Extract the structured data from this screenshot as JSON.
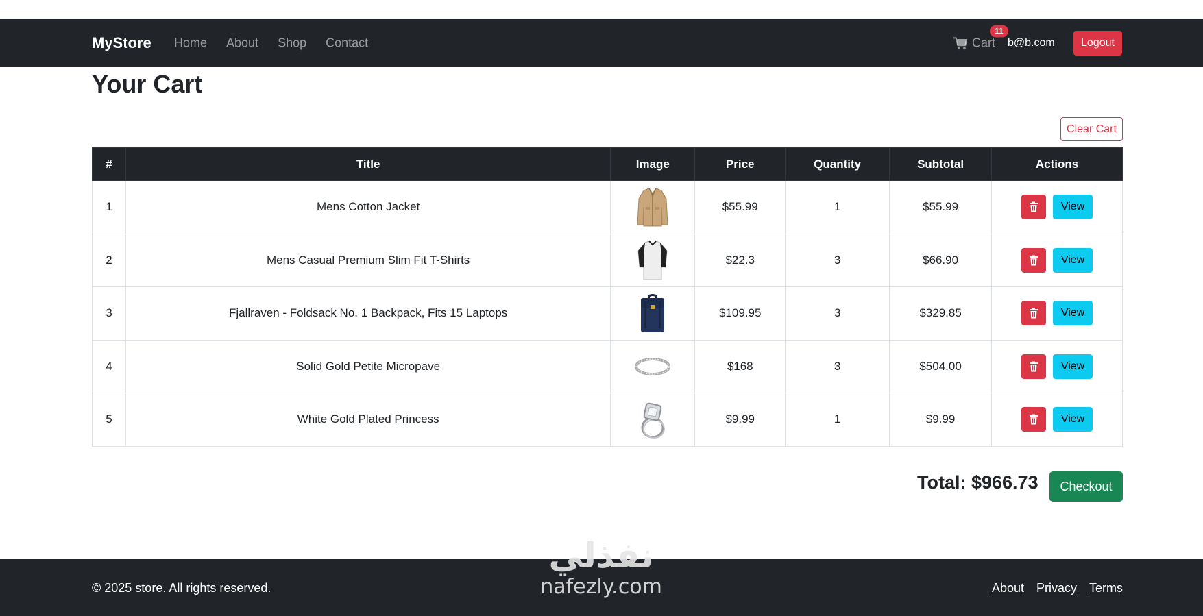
{
  "navbar": {
    "brand": "MyStore",
    "links": [
      "Home",
      "About",
      "Shop",
      "Contact"
    ],
    "cart_label": "Cart",
    "cart_count": "11",
    "user_email": "b@b.com",
    "logout_label": "Logout"
  },
  "main": {
    "title": "Your Cart",
    "clear_cart_label": "Clear Cart",
    "table": {
      "headers": [
        "#",
        "Title",
        "Image",
        "Price",
        "Quantity",
        "Subtotal",
        "Actions"
      ],
      "rows": [
        {
          "num": "1",
          "title": "Mens Cotton Jacket",
          "image": "jacket",
          "price": "$55.99",
          "quantity": "1",
          "subtotal": "$55.99"
        },
        {
          "num": "2",
          "title": "Mens Casual Premium Slim Fit T-Shirts",
          "image": "tshirt",
          "price": "$22.3",
          "quantity": "3",
          "subtotal": "$66.90"
        },
        {
          "num": "3",
          "title": "Fjallraven - Foldsack No. 1 Backpack, Fits 15 Laptops",
          "image": "backpack",
          "price": "$109.95",
          "quantity": "3",
          "subtotal": "$329.85"
        },
        {
          "num": "4",
          "title": "Solid Gold Petite Micropave",
          "image": "bracelet",
          "price": "$168",
          "quantity": "3",
          "subtotal": "$504.00"
        },
        {
          "num": "5",
          "title": "White Gold Plated Princess",
          "image": "ring",
          "price": "$9.99",
          "quantity": "1",
          "subtotal": "$9.99"
        }
      ],
      "view_label": "View",
      "delete_icon": "trash-icon"
    },
    "total_label": "Total: $966.73",
    "checkout_label": "Checkout"
  },
  "footer": {
    "copyright": "© 2025 store. All rights reserved.",
    "links": [
      "About",
      "Privacy",
      "Terms"
    ]
  },
  "watermark": {
    "arabic": "نفذلي",
    "latin": "nafezly.com"
  },
  "colors": {
    "navbar_bg": "#212529",
    "danger": "#dc3545",
    "info": "#0dcaf0",
    "success": "#198754"
  }
}
